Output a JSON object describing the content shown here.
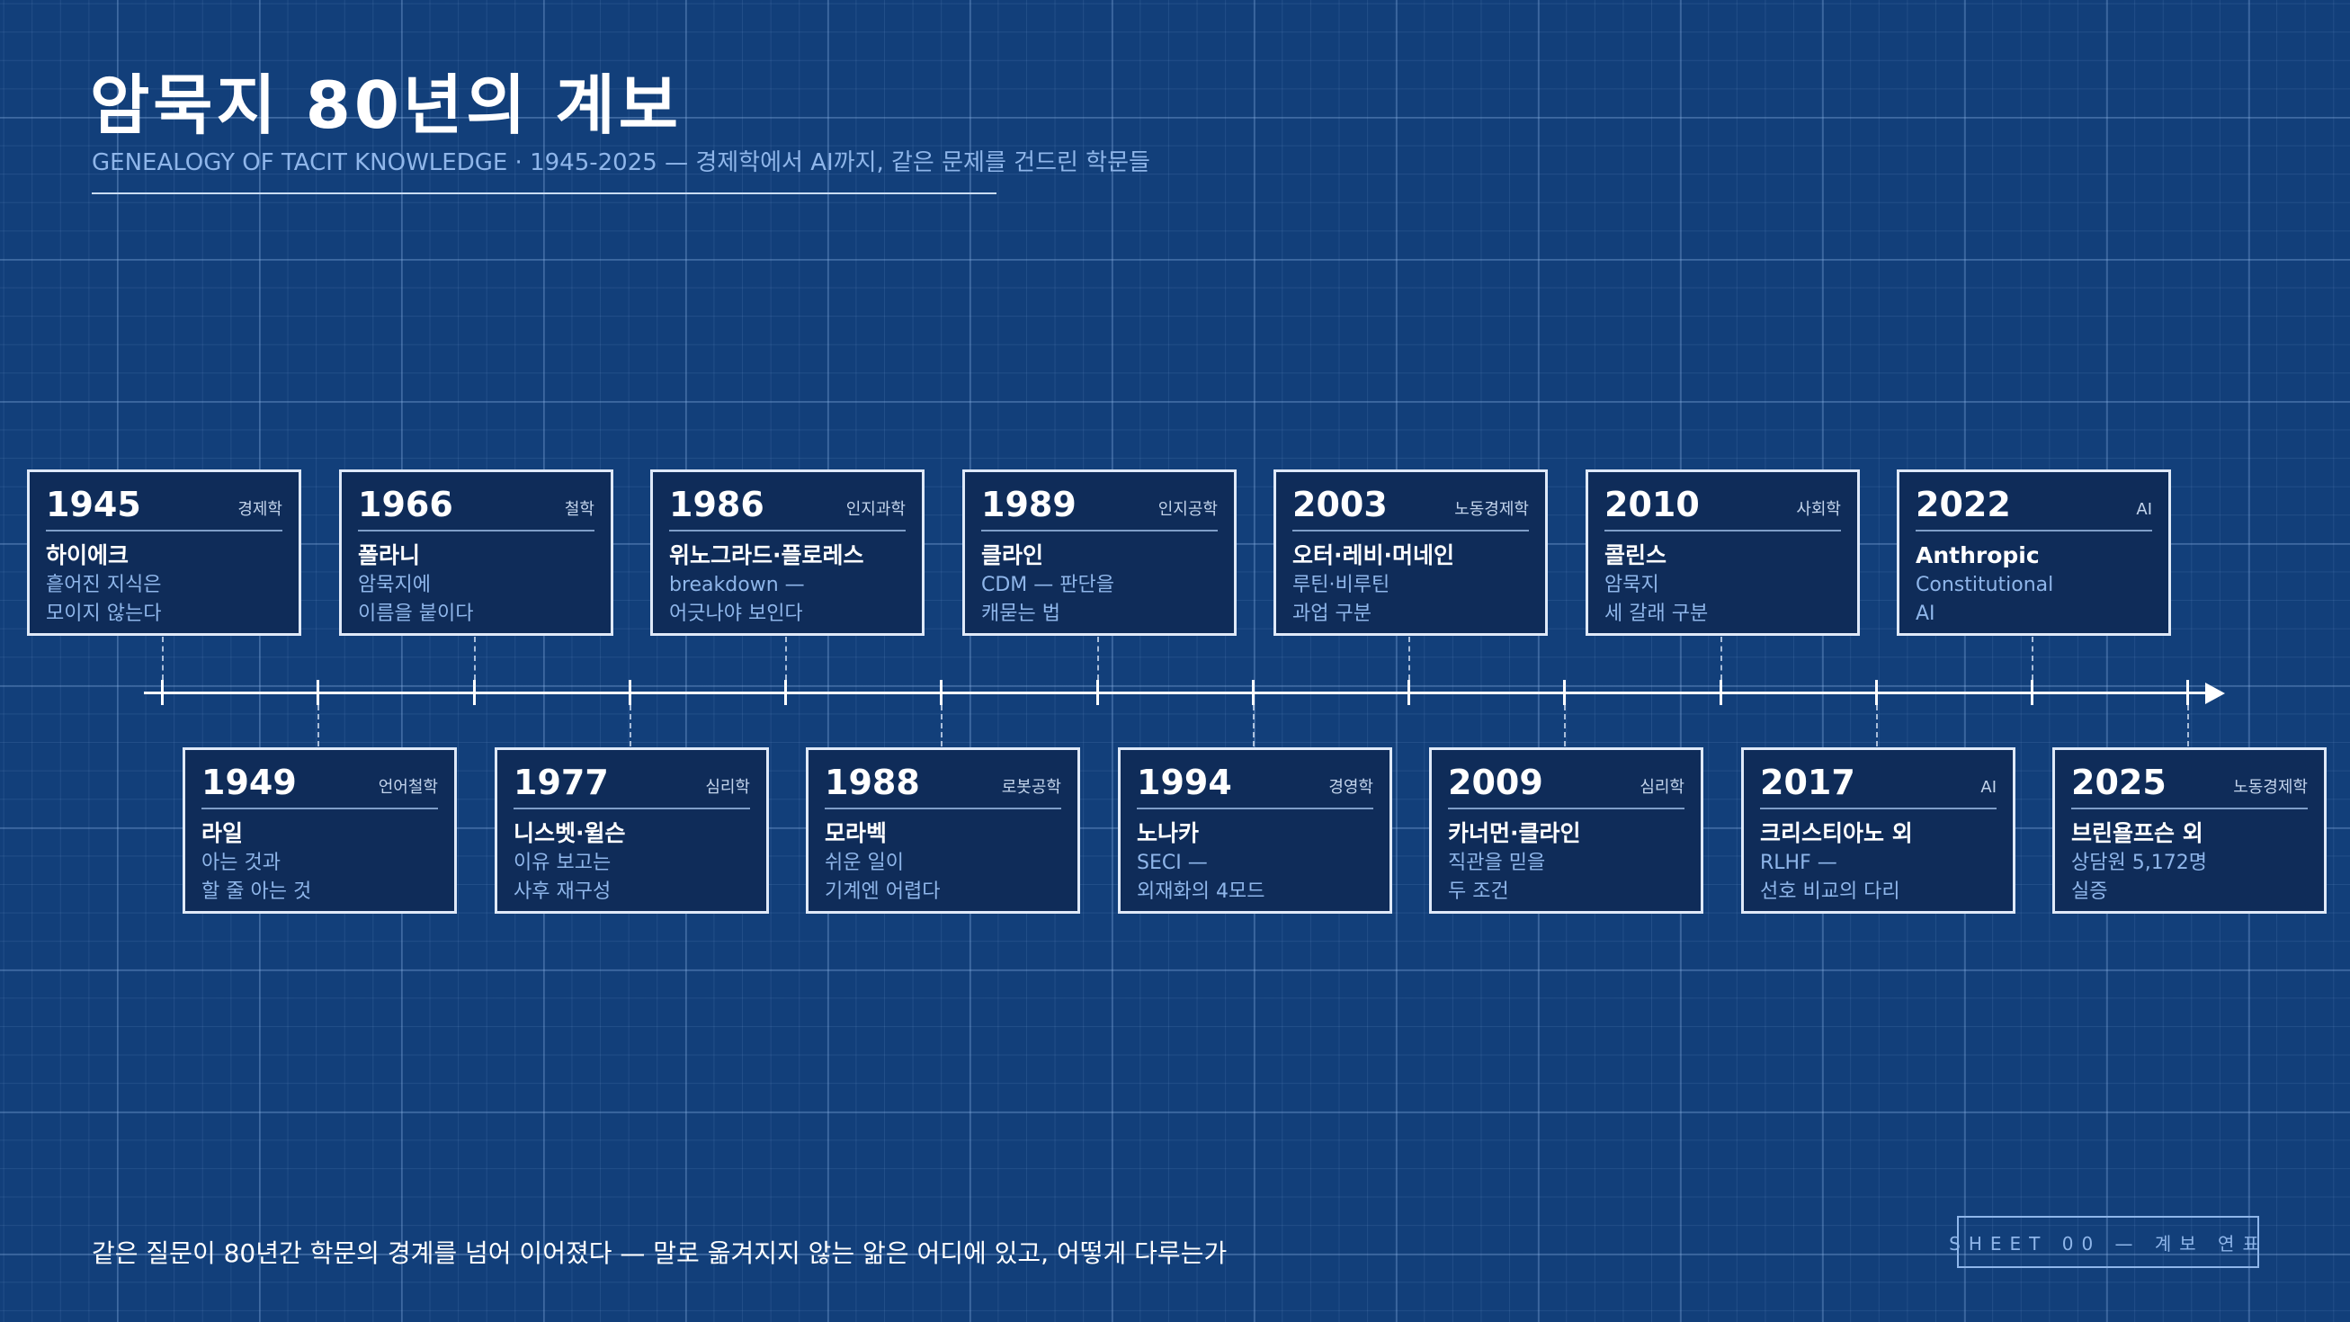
{
  "title": "암묵지 80년의 계보",
  "subtitle": "GENEALOGY OF TACIT KNOWLEDGE · 1945-2025 — 경제학에서 AI까지, 같은 문제를 건드린 학문들",
  "top_entries": [
    {
      "year": "1945",
      "field": "경제학",
      "name": "하이에크",
      "desc1": "흩어진 지식은",
      "desc2": "모이지 않는다"
    },
    {
      "year": "1966",
      "field": "철학",
      "name": "폴라니",
      "desc1": "암묵지에",
      "desc2": "이름을 붙이다"
    },
    {
      "year": "1986",
      "field": "인지과학",
      "name": "위노그라드·플로레스",
      "desc1": "breakdown —",
      "desc2": "어긋나야 보인다"
    },
    {
      "year": "1989",
      "field": "인지공학",
      "name": "클라인",
      "desc1": "CDM — 판단을",
      "desc2": "캐묻는 법"
    },
    {
      "year": "2003",
      "field": "노동경제학",
      "name": "오터·레비·머네인",
      "desc1": "루틴·비루틴",
      "desc2": "과업 구분"
    },
    {
      "year": "2010",
      "field": "사회학",
      "name": "콜린스",
      "desc1": "암묵지",
      "desc2": "세 갈래 구분"
    },
    {
      "year": "2022",
      "field": "AI",
      "name": "Anthropic",
      "desc1": "Constitutional",
      "desc2": "AI"
    }
  ],
  "bottom_entries": [
    {
      "year": "1949",
      "field": "언어철학",
      "name": "라일",
      "desc1": "아는 것과",
      "desc2": "할 줄 아는 것"
    },
    {
      "year": "1977",
      "field": "심리학",
      "name": "니스벳·윌슨",
      "desc1": "이유 보고는",
      "desc2": "사후 재구성"
    },
    {
      "year": "1988",
      "field": "로봇공학",
      "name": "모라벡",
      "desc1": "쉬운 일이",
      "desc2": "기계엔 어렵다"
    },
    {
      "year": "1994",
      "field": "경영학",
      "name": "노나카",
      "desc1": "SECI —",
      "desc2": "외재화의 4모드"
    },
    {
      "year": "2009",
      "field": "심리학",
      "name": "카너먼·클라인",
      "desc1": "직관을 믿을",
      "desc2": "두 조건"
    },
    {
      "year": "2017",
      "field": "AI",
      "name": "크리스티아노 외",
      "desc1": "RLHF —",
      "desc2": "선호 비교의 다리"
    },
    {
      "year": "2025",
      "field": "노동경제학",
      "name": "브린욜프슨 외",
      "desc1": "상담원 5,172명",
      "desc2": "실증"
    }
  ],
  "footer": "같은 질문이 80년간 학문의 경계를 넘어 이어졌다 — 말로 옮겨지지 않는 앎은 어디에 있고, 어떻게 다루는가",
  "sheet_label": "SHEET 00 — 계보 연표",
  "colors": {
    "background": "#123f7a",
    "card": "#0f2c59",
    "accent_text": "#8fb6ea",
    "line": "#ffffff"
  }
}
